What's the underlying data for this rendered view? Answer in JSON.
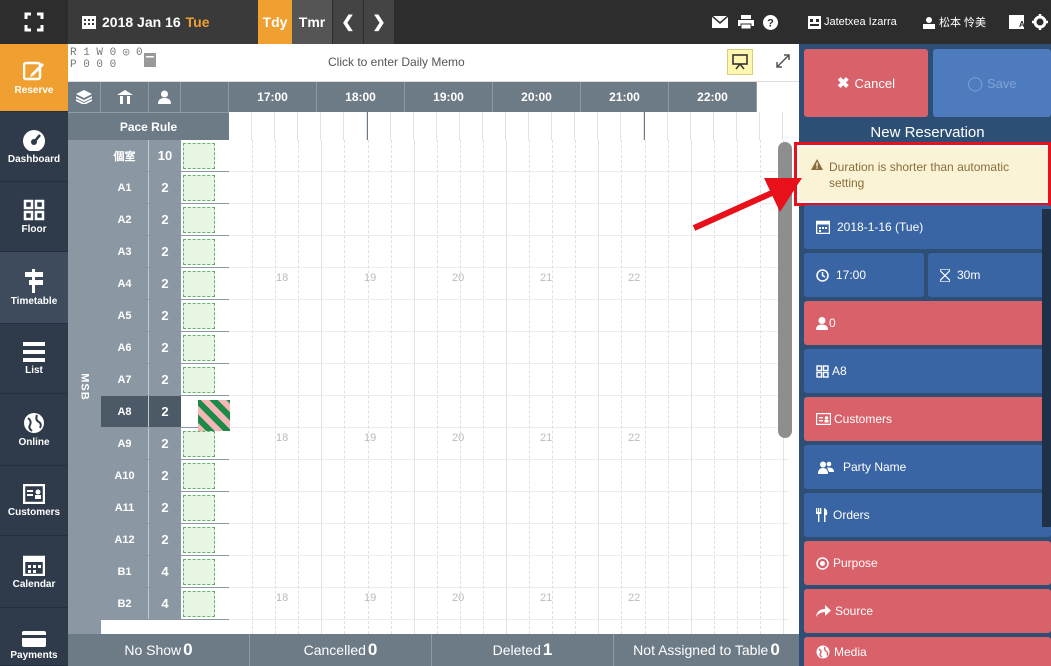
{
  "topbar": {
    "date_label": "2018 Jan 16",
    "weekday": "Tue",
    "today_btn": "Tdy",
    "tomorrow_btn": "Tmr",
    "user_name": "Jatetxea Izarra",
    "staff_name": "松本 怜美"
  },
  "counters": {
    "r_line": "R 1 W 0 ◎ 0",
    "p_line": "P 0  0  0"
  },
  "memo": {
    "placeholder": "Click to enter Daily Memo"
  },
  "sidebar": {
    "items": [
      {
        "label": "Reserve",
        "icon": "edit-icon"
      },
      {
        "label": "Dashboard",
        "icon": "dashboard-icon"
      },
      {
        "label": "Floor",
        "icon": "floor-icon"
      },
      {
        "label": "Timetable",
        "icon": "timetable-icon"
      },
      {
        "label": "List",
        "icon": "list-icon"
      },
      {
        "label": "Online",
        "icon": "globe-icon"
      },
      {
        "label": "Customers",
        "icon": "customers-icon"
      },
      {
        "label": "Calendar",
        "icon": "calendar-icon"
      },
      {
        "label": "Payments",
        "icon": "payments-icon"
      }
    ]
  },
  "grid": {
    "times": [
      "17:00",
      "18:00",
      "19:00",
      "20:00",
      "21:00",
      "22:00"
    ],
    "pace_rule": "Pace Rule",
    "group_label": "MSB",
    "watermark_hours": [
      "18",
      "19",
      "20",
      "21",
      "22"
    ],
    "tables": [
      {
        "name": "個室",
        "cap": "10"
      },
      {
        "name": "A1",
        "cap": "2"
      },
      {
        "name": "A2",
        "cap": "2"
      },
      {
        "name": "A3",
        "cap": "2"
      },
      {
        "name": "A4",
        "cap": "2"
      },
      {
        "name": "A5",
        "cap": "2"
      },
      {
        "name": "A6",
        "cap": "2"
      },
      {
        "name": "A7",
        "cap": "2"
      },
      {
        "name": "A8",
        "cap": "2"
      },
      {
        "name": "A9",
        "cap": "2"
      },
      {
        "name": "A10",
        "cap": "2"
      },
      {
        "name": "A11",
        "cap": "2"
      },
      {
        "name": "A12",
        "cap": "2"
      },
      {
        "name": "B1",
        "cap": "4"
      },
      {
        "name": "B2",
        "cap": "4"
      }
    ],
    "selected_table": "A8"
  },
  "footer": {
    "no_show_label": "No Show",
    "no_show_count": "0",
    "cancelled_label": "Cancelled",
    "cancelled_count": "0",
    "deleted_label": "Deleted",
    "deleted_count": "1",
    "unassigned_label": "Not Assigned to Table",
    "unassigned_count": "0"
  },
  "panel": {
    "cancel": "Cancel",
    "save": "Save",
    "title": "New Reservation",
    "warning": "Duration is shorter than automatic setting",
    "date": "2018-1-16 (Tue)",
    "time": "17:00",
    "duration": "30m",
    "guests": "0",
    "table": "A8",
    "customers": "Customers",
    "party_name": "Party Name",
    "orders": "Orders",
    "purpose": "Purpose",
    "source": "Source",
    "media": "Media"
  },
  "colors": {
    "topbar": "#2d2d2d",
    "accent_orange": "#f0a030",
    "sidebar": "#2f3b4a",
    "grid_header": "#6d7b87",
    "panel_blue": "#3a65a4",
    "panel_red": "#d9616a",
    "warning_bg": "#fbf3d5",
    "highlight_red": "#e8101a"
  }
}
